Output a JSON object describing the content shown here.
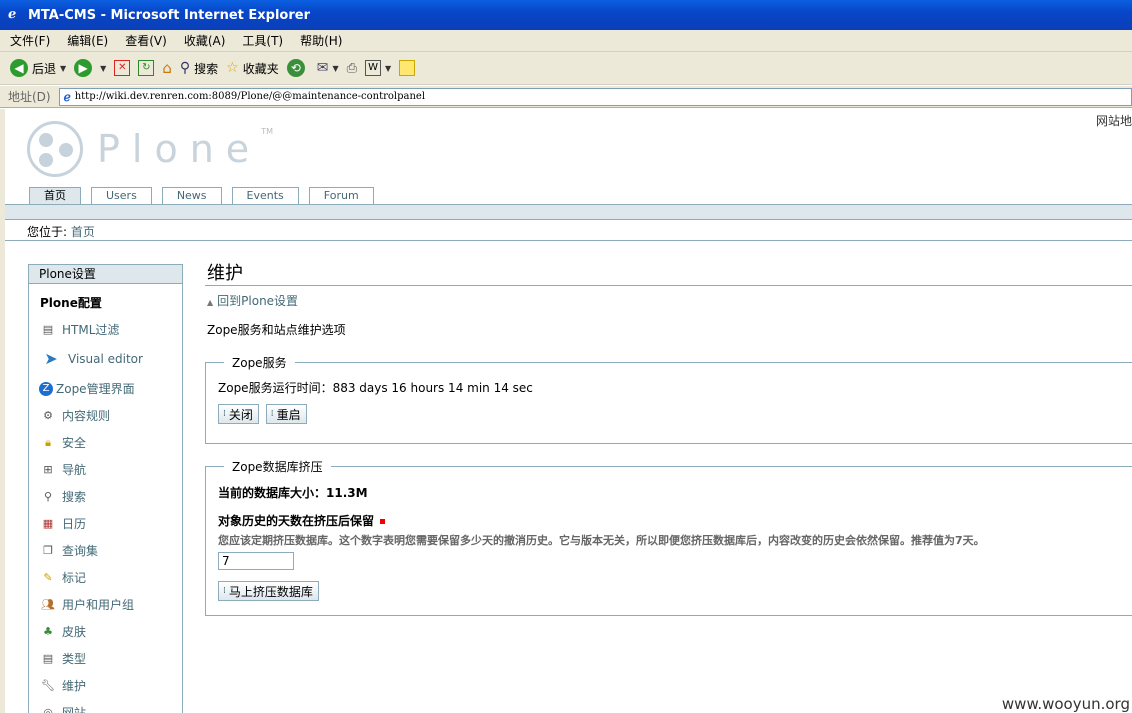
{
  "window": {
    "title": "MTA-CMS - Microsoft Internet Explorer"
  },
  "menu": [
    "文件(F)",
    "编辑(E)",
    "查看(V)",
    "收藏(A)",
    "工具(T)",
    "帮助(H)"
  ],
  "toolbar": {
    "back": "后退",
    "search": "搜索",
    "favorites": "收藏夹"
  },
  "address": {
    "label": "地址(D)",
    "url": "http://wiki.dev.renren.com:8089/Plone/@@maintenance-controlpanel"
  },
  "site": {
    "actions": "网站地",
    "logo_text": "Plone",
    "logo_tm": "TM",
    "tabs": [
      "首页",
      "Users",
      "News",
      "Events",
      "Forum"
    ],
    "breadcrumb_label": "您位于:",
    "breadcrumb_link": "首页"
  },
  "portlet": {
    "header": "Plone设置",
    "current": "Plone配置",
    "items": [
      "HTML过滤",
      "Visual editor",
      "Zope管理界面",
      "内容规则",
      "安全",
      "导航",
      "搜索",
      "日历",
      "查询集",
      "标记",
      "用户和用户组",
      "皮肤",
      "类型",
      "维护",
      "网站"
    ]
  },
  "main": {
    "title": "维护",
    "up_link": "回到Plone设置",
    "description": "Zope服务和站点维护选项",
    "zope": {
      "legend": "Zope服务",
      "uptime": "Zope服务运行时间：883 days 16 hours 14 min 14 sec",
      "shutdown": "关闭",
      "restart": "重启"
    },
    "pack": {
      "legend": "Zope数据库挤压",
      "size": "当前的数据库大小：11.3M",
      "days_label": "对象历史的天数在挤压后保留",
      "help": "您应该定期挤压数据库。这个数字表明您需要保留多少天的撤消历史。它与版本无关，所以即便您挤压数据库后，内容改变的历史会依然保留。推荐值为7天。",
      "days_value": "7",
      "button": "马上挤压数据库"
    }
  },
  "watermark": "www.wooyun.org"
}
